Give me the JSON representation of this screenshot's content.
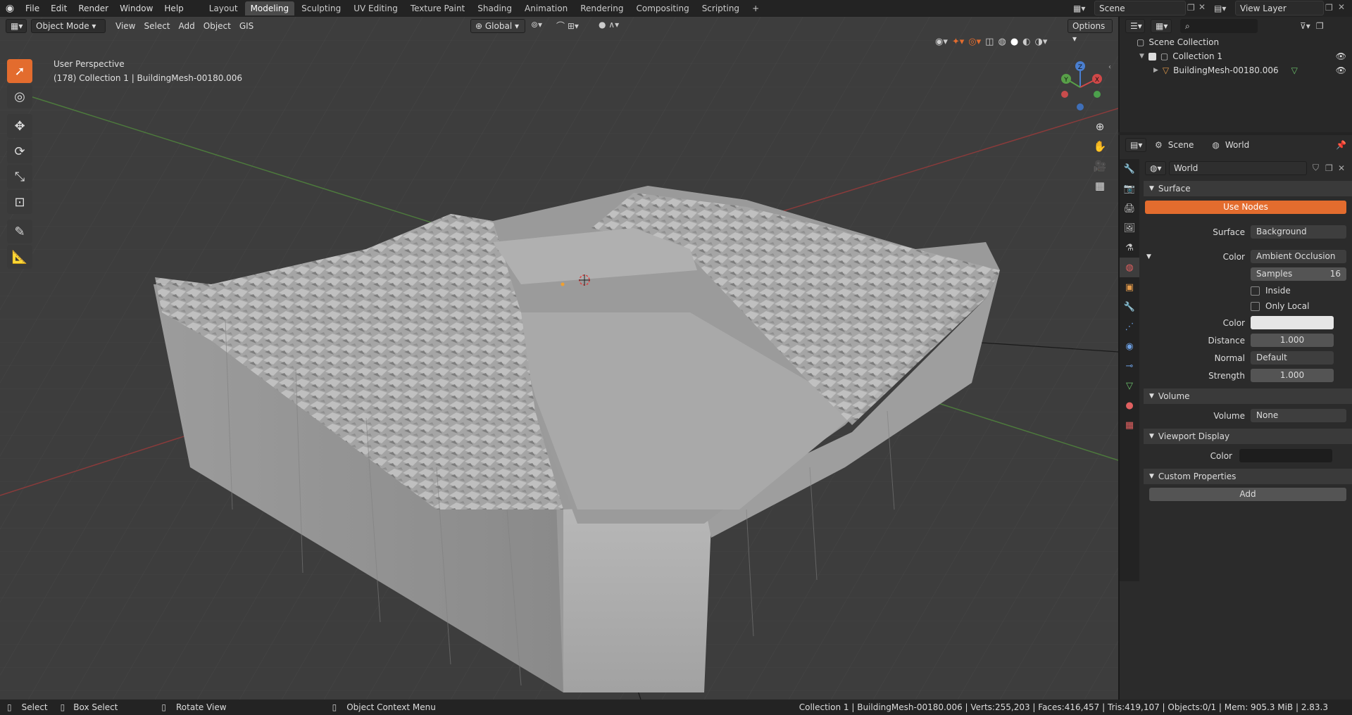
{
  "menu": [
    "File",
    "Edit",
    "Render",
    "Window",
    "Help"
  ],
  "workspaces": [
    {
      "label": "Layout"
    },
    {
      "label": "Modeling"
    },
    {
      "label": "Sculpting"
    },
    {
      "label": "UV Editing"
    },
    {
      "label": "Texture Paint"
    },
    {
      "label": "Shading"
    },
    {
      "label": "Animation"
    },
    {
      "label": "Rendering"
    },
    {
      "label": "Compositing"
    },
    {
      "label": "Scripting"
    }
  ],
  "active_workspace": "Modeling",
  "scene_name": "Scene",
  "view_layer": "View Layer",
  "viewport": {
    "mode": "Object Mode",
    "menus": [
      "View",
      "Select",
      "Add",
      "Object",
      "GIS"
    ],
    "transform_orientation": "Global",
    "options_label": "Options",
    "perspective_label": "User Perspective",
    "collection_label": "(178) Collection 1 | BuildingMesh-00180.006",
    "gizmo": {
      "x": "X",
      "y": "Y",
      "z": "Z"
    }
  },
  "outliner": {
    "root": "Scene Collection",
    "collection": "Collection 1",
    "object": "BuildingMesh-00180.006"
  },
  "properties": {
    "breadcrumb_scene": "Scene",
    "breadcrumb_world": "World",
    "world_name": "World",
    "surface_panel": "Surface",
    "use_nodes": "Use Nodes",
    "surface_label": "Surface",
    "surface_value": "Background",
    "color_label": "Color",
    "color_value": "Ambient Occlusion",
    "samples_label": "Samples",
    "samples_value": "16",
    "inside_label": "Inside",
    "only_local_label": "Only Local",
    "ao_color_label": "Color",
    "distance_label": "Distance",
    "distance_value": "1.000",
    "normal_label": "Normal",
    "normal_value": "Default",
    "strength_label": "Strength",
    "strength_value": "1.000",
    "volume_panel": "Volume",
    "volume_label": "Volume",
    "volume_value": "None",
    "viewport_display_panel": "Viewport Display",
    "vd_color_label": "Color",
    "custom_props_panel": "Custom Properties",
    "add_label": "Add"
  },
  "statusbar": {
    "select": "Select",
    "box_select": "Box Select",
    "rotate_view": "Rotate View",
    "context_menu": "Object Context Menu",
    "stats": "Collection 1 | BuildingMesh-00180.006 | Verts:255,203 | Faces:416,457 | Tris:419,107 | Objects:0/1 | Mem: 905.3 MiB | 2.83.3"
  },
  "colors": {
    "accent": "#e36c2e",
    "active_tab": "#4a4a4a",
    "background": "#3d3d3d"
  }
}
